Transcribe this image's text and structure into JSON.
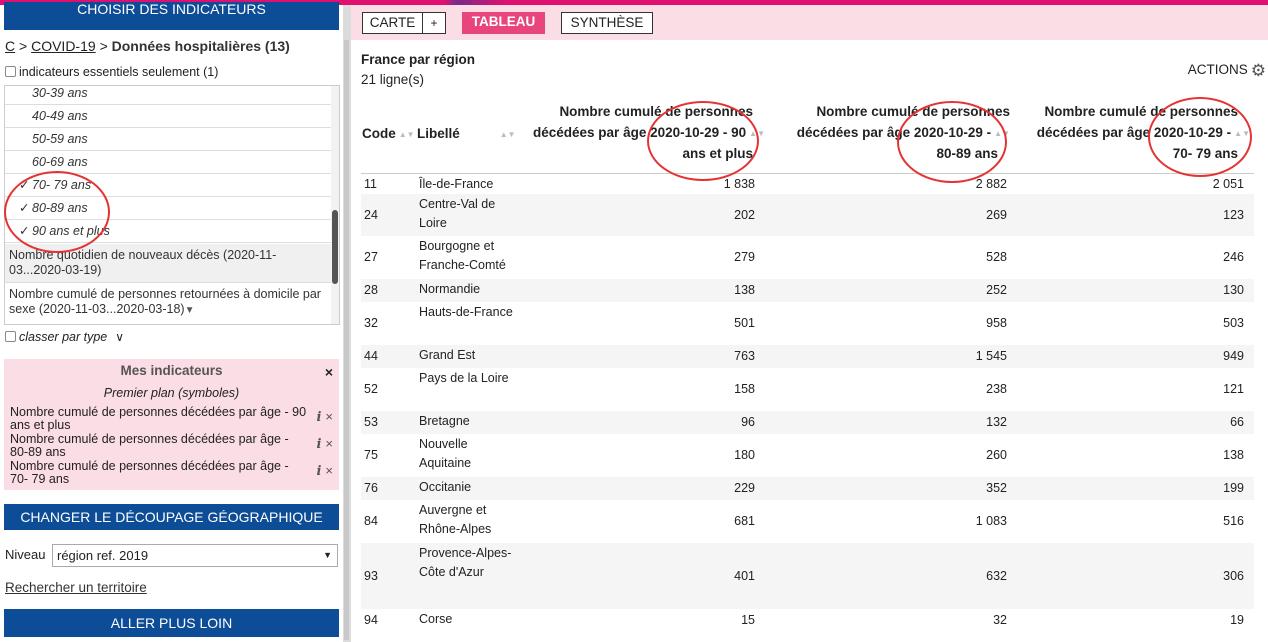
{
  "left": {
    "choisir_label": "CHOISIR DES INDICATEURS",
    "breadcrumb": {
      "c": "C",
      "sep1": ">",
      "covid": "COVID-19",
      "sep2": ">",
      "current": "Données hospitalières (13)"
    },
    "essentiels_label": "indicateurs essentiels seulement (1)",
    "indicator_items": [
      {
        "label": "30-39 ans",
        "checked": ""
      },
      {
        "label": "40-49 ans",
        "checked": ""
      },
      {
        "label": "50-59 ans",
        "checked": ""
      },
      {
        "label": "60-69 ans",
        "checked": ""
      },
      {
        "label": "70- 79 ans",
        "checked": "✓"
      },
      {
        "label": "80-89 ans",
        "checked": "✓"
      },
      {
        "label": "90 ans et plus",
        "checked": "✓"
      }
    ],
    "indicator_groups": [
      "Nombre quotidien de nouveaux décès (2020-11-03...2020-03-19)",
      "Nombre cumulé de personnes retournées à domicile par sexe (2020-11-03...2020-03-18)"
    ],
    "group_expand_icon": "▼",
    "classer_label": "classer par type",
    "classer_icon": "∨",
    "mes": {
      "title": "Mes indicateurs",
      "close": "×",
      "subtitle": "Premier plan (symboles)",
      "items": [
        "Nombre cumulé de personnes décédées par âge - 90 ans et plus",
        "Nombre cumulé de personnes décédées par âge - 80-89 ans",
        "Nombre cumulé de personnes décédées par âge - 70- 79 ans"
      ],
      "info_icon": "i",
      "remove_icon": "×"
    },
    "decoupage_label": "CHANGER LE DÉCOUPAGE GÉOGRAPHIQUE",
    "niveau_label": "Niveau",
    "niveau_value": "région ref. 2019",
    "select_arrow": "▼",
    "recherche_label": "Rechercher un territoire",
    "aller_label": "ALLER PLUS LOIN"
  },
  "tabs": {
    "carte": "CARTE",
    "plus": "+",
    "tableau": "TABLEAU",
    "synthese": "SYNTHÈSE"
  },
  "view": {
    "title": "France par région",
    "row_count": "21 ligne(s)",
    "actions": "ACTIONS",
    "gear_icon": "⚙"
  },
  "table": {
    "columns": {
      "code": "Code",
      "libelle": "Libellé",
      "col90": [
        "Nombre cumulé de personnes",
        "décédées par âge 2020-10-29 - 90",
        "ans et plus"
      ],
      "col80": [
        "Nombre cumulé de personnes",
        "décédées par âge 2020-10-29 -",
        "80-89 ans"
      ],
      "col70": [
        "Nombre cumulé de personnes",
        "décédées par âge 2020-10-29 -",
        "70- 79 ans"
      ]
    },
    "sort_icon": "▲▼",
    "rows": [
      {
        "code": "11",
        "libelle": "Île-de-France",
        "v90": "1 838",
        "v80": "2 882",
        "v70": "2 051"
      },
      {
        "code": "24",
        "libelle": "Centre-Val de Loire",
        "v90": "202",
        "v80": "269",
        "v70": "123"
      },
      {
        "code": "27",
        "libelle": "Bourgogne et Franche-Comté",
        "v90": "279",
        "v80": "528",
        "v70": "246"
      },
      {
        "code": "28",
        "libelle": "Normandie",
        "v90": "138",
        "v80": "252",
        "v70": "130"
      },
      {
        "code": "32",
        "libelle": "Hauts-de-France",
        "v90": "501",
        "v80": "958",
        "v70": "503"
      },
      {
        "code": "44",
        "libelle": "Grand Est",
        "v90": "763",
        "v80": "1 545",
        "v70": "949"
      },
      {
        "code": "52",
        "libelle": "Pays de la Loire",
        "v90": "158",
        "v80": "238",
        "v70": "121"
      },
      {
        "code": "53",
        "libelle": "Bretagne",
        "v90": "96",
        "v80": "132",
        "v70": "66"
      },
      {
        "code": "75",
        "libelle": "Nouvelle Aquitaine",
        "v90": "180",
        "v80": "260",
        "v70": "138"
      },
      {
        "code": "76",
        "libelle": "Occitanie",
        "v90": "229",
        "v80": "352",
        "v70": "199"
      },
      {
        "code": "84",
        "libelle": "Auvergne et Rhône-Alpes",
        "v90": "681",
        "v80": "1 083",
        "v70": "516"
      },
      {
        "code": "93",
        "libelle": "Provence-Alpes-Côte d'Azur",
        "v90": "401",
        "v80": "632",
        "v70": "306"
      },
      {
        "code": "94",
        "libelle": "Corse",
        "v90": "15",
        "v80": "32",
        "v70": "19"
      }
    ]
  },
  "colors": {
    "accent_pink": "#e7457c",
    "panel_pink": "#fbdde5",
    "nav_blue": "#0d4c96",
    "annotation_red": "#e53333"
  }
}
